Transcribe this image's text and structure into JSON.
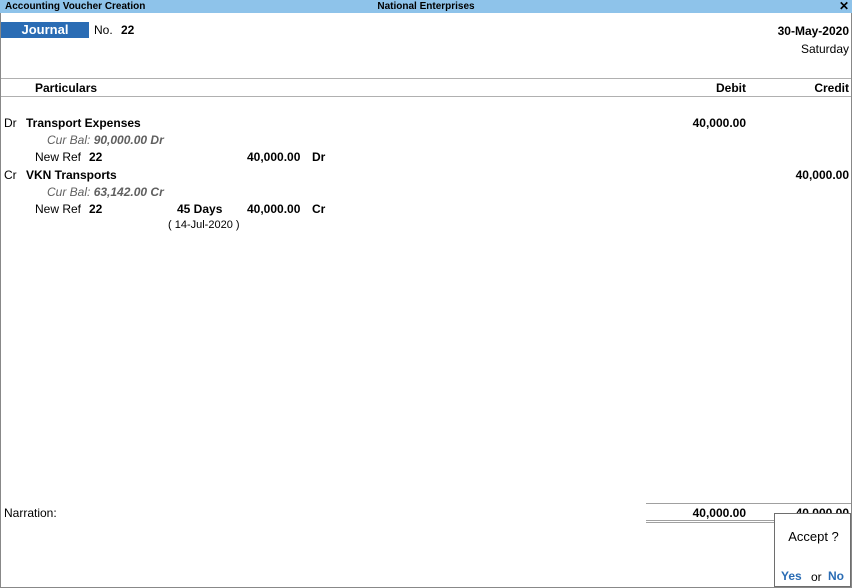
{
  "window": {
    "title": "Accounting Voucher  Creation",
    "company": "National Enterprises",
    "close_symbol": "✕"
  },
  "voucher": {
    "type": "Journal",
    "no_label": "No.",
    "number": "22",
    "date": "30-May-2020",
    "day": "Saturday"
  },
  "columns": {
    "particulars": "Particulars",
    "debit": "Debit",
    "credit": "Credit"
  },
  "entries": [
    {
      "drcr": "Dr",
      "ledger": "Transport Expenses",
      "cur_bal_label": "Cur Bal:",
      "cur_bal_value": "90,000.00 Dr",
      "amount": "40,000.00",
      "bill_type": "New Ref",
      "bill_name": "22",
      "bill_amount": "40,000.00",
      "bill_drcr": "Dr"
    },
    {
      "drcr": "Cr",
      "ledger": "VKN Transports",
      "cur_bal_label": "Cur Bal:",
      "cur_bal_value": "63,142.00 Cr",
      "amount": "40,000.00",
      "bill_type": "New Ref",
      "bill_name": "22",
      "credit_period": "45 Days",
      "due_date": "( 14-Jul-2020 )",
      "bill_amount": "40,000.00",
      "bill_drcr": "Cr"
    }
  ],
  "footer": {
    "narration_label": "Narration:",
    "total_debit": "40,000.00",
    "total_credit": "40,000.00"
  },
  "dialog": {
    "question": "Accept ?",
    "yes": "Yes",
    "or": "or",
    "no": "No"
  },
  "colors": {
    "titlebar": "#8ec3ea",
    "voucher_type_bg": "#2a6cb4",
    "link_blue": "#2a6cb4"
  }
}
